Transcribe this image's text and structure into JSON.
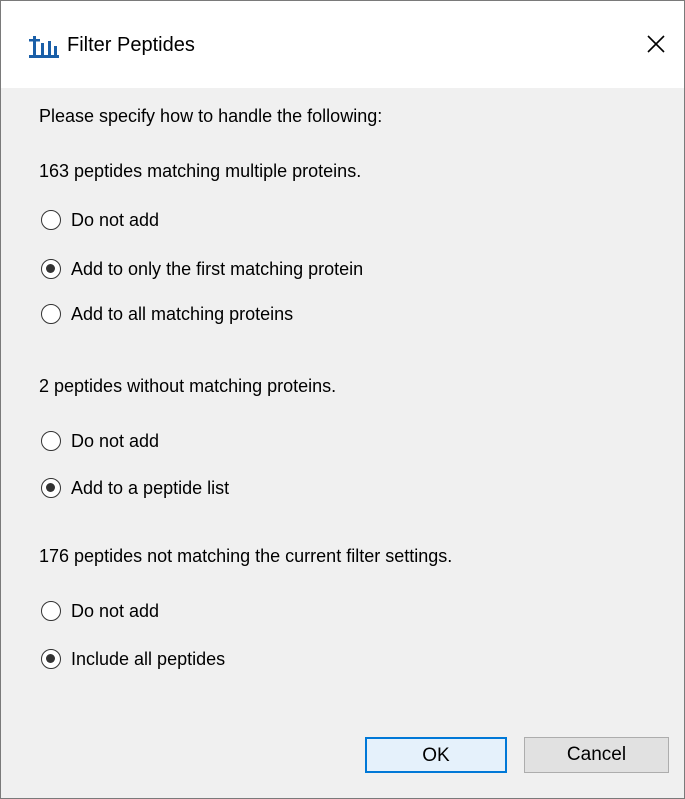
{
  "window": {
    "title": "Filter Peptides"
  },
  "dialog": {
    "intro": "Please specify how to handle the following:",
    "groups": [
      {
        "heading": "163 peptides matching multiple proteins.",
        "options": [
          {
            "label": "Do not add",
            "selected": false
          },
          {
            "label": "Add to only the first matching protein",
            "selected": true
          },
          {
            "label": "Add to all matching proteins",
            "selected": false
          }
        ]
      },
      {
        "heading": "2 peptides without matching proteins.",
        "options": [
          {
            "label": "Do not add",
            "selected": false
          },
          {
            "label": "Add to a peptide list",
            "selected": true
          }
        ]
      },
      {
        "heading": "176 peptides not matching the current filter settings.",
        "options": [
          {
            "label": "Do not add",
            "selected": false
          },
          {
            "label": "Include all peptides",
            "selected": true
          }
        ]
      }
    ]
  },
  "buttons": {
    "ok_label": "OK",
    "cancel_label": "Cancel"
  },
  "icons": {
    "app": "peptide-chart-icon",
    "close": "close-icon"
  },
  "colors": {
    "accent": "#0078d7",
    "dialog_background": "#f0f0f0",
    "titlebar_background": "#ffffff",
    "app_icon": "#1a5fa8"
  }
}
